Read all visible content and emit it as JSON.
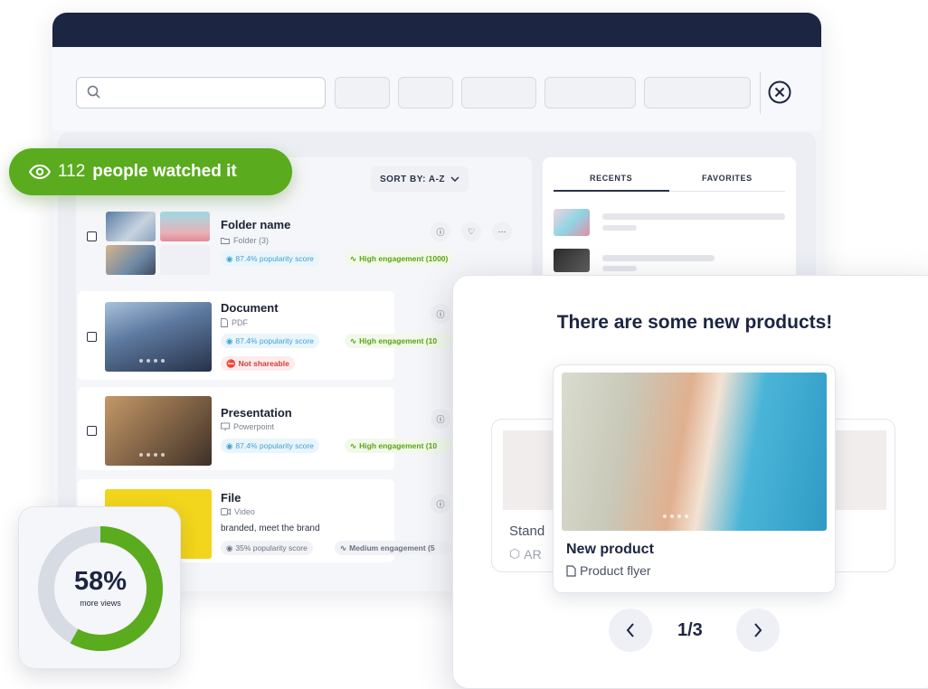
{
  "search": {
    "placeholder": ""
  },
  "sort": {
    "label": "SORT BY: A-Z"
  },
  "badge": {
    "count": "112",
    "label": "people watched it"
  },
  "tabs": {
    "recents": "RECENTS",
    "favorites": "FAVORITES"
  },
  "rows": [
    {
      "title": "Folder name",
      "subtitle": "Folder (3)",
      "popularity": "87.4% popularity score",
      "engagement": "High engagement (1000)"
    },
    {
      "title": "Document",
      "subtitle": "PDF",
      "popularity": "87.4% popularity score",
      "engagement": "High engagement (10",
      "warning": "Not shareable"
    },
    {
      "title": "Presentation",
      "subtitle": "Powerpoint",
      "popularity": "87.4% popularity score",
      "engagement": "High engagement (10"
    },
    {
      "title": "File",
      "subtitle": "Video",
      "description": "branded, meet the brand",
      "popularity": "35% popularity score",
      "engagement": "Medium engagement (5"
    }
  ],
  "popup": {
    "title": "There are some new products!",
    "product_name": "New product",
    "product_type": "Product flyer",
    "ghost_name": "Stand",
    "ghost_type": "AR",
    "pager": "1/3"
  },
  "views": {
    "percent_label": "58%",
    "caption": "more views",
    "fraction": 0.58
  },
  "colors": {
    "accent_green": "#5aab1e",
    "navy": "#1c2542",
    "blue_tag": "#3ca2d6"
  },
  "icons": [
    "search-icon",
    "close-circle-icon",
    "eye-icon",
    "chevron-down-icon",
    "info-icon",
    "heart-icon",
    "more-icon",
    "folder-icon",
    "file-icon",
    "presentation-icon",
    "video-icon",
    "chevron-left-icon",
    "chevron-right-icon",
    "cube-icon"
  ]
}
